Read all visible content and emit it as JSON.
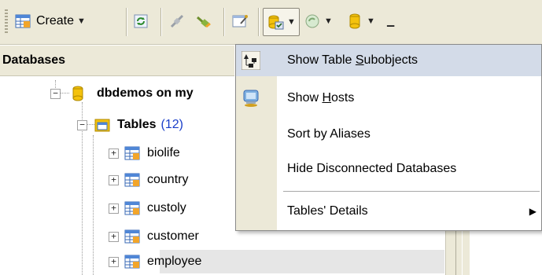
{
  "toolbar": {
    "create_label": "Create",
    "buttons": [
      "create",
      "refresh",
      "disconnect",
      "connect",
      "properties",
      "view-options",
      "tools",
      "database"
    ]
  },
  "panel": {
    "title": "Databases"
  },
  "tree": {
    "database_label": "dbdemos on my",
    "tables_label": "Tables",
    "tables_count": "(12)",
    "items": [
      {
        "label": "biolife"
      },
      {
        "label": "country"
      },
      {
        "label": "custoly"
      },
      {
        "label": "customer"
      },
      {
        "label": "employee"
      }
    ]
  },
  "context_menu": {
    "items": [
      {
        "before": "Show Table ",
        "mnemonic": "S",
        "after": "ubobjects"
      },
      {
        "before": "Show ",
        "mnemonic": "H",
        "after": "osts"
      },
      {
        "label": "Sort by Aliases"
      },
      {
        "label": "Hide Disconnected Databases"
      },
      {
        "label": "Tables' Details"
      }
    ]
  },
  "colors": {
    "chrome": "#ece9d8",
    "highlight": "#d3dbe8",
    "count_blue": "#1a3ec9",
    "db_yellow": "#f4c20d"
  }
}
